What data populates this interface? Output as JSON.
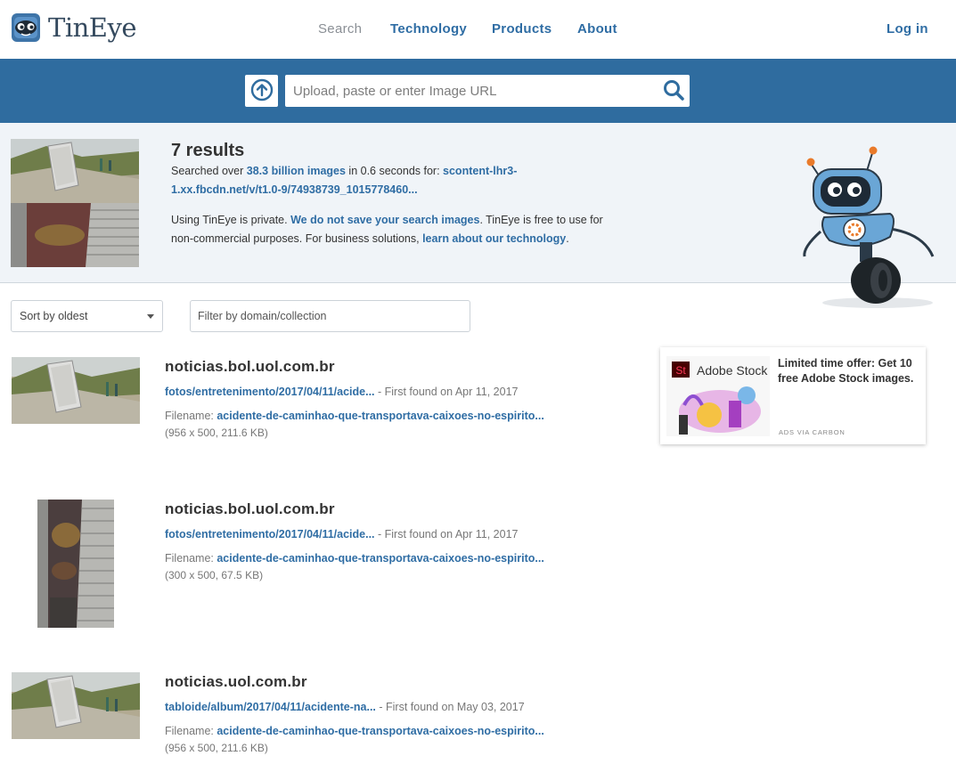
{
  "brand": {
    "name": "TinEye",
    "icon": "tineye-logo-icon"
  },
  "nav": {
    "items": [
      {
        "label": "Search",
        "active": true
      },
      {
        "label": "Technology"
      },
      {
        "label": "Products"
      },
      {
        "label": "About"
      }
    ],
    "login": "Log in"
  },
  "search": {
    "placeholder": "Upload, paste or enter Image URL",
    "upload_icon": "upload-arrow-icon",
    "search_icon": "magnifier-icon"
  },
  "summary": {
    "count": "7 results",
    "searched_prefix": "Searched over ",
    "images_count": "38.3 billion images",
    "searched_middle": " in 0.6 seconds for: ",
    "query_url": "scontent-lhr3-1.xx.fbcdn.net/v/t1.0-9/74938739_1015778460...",
    "privacy_1": "Using TinEye is private. ",
    "privacy_link": "We do not save your search images",
    "privacy_2": ". TinEye is free to use for non-commercial purposes. For business solutions, ",
    "tech_link": "learn about our technology",
    "privacy_3": "."
  },
  "filters": {
    "sort_selected": "Sort by oldest",
    "filter_placeholder": "Filter by domain/collection"
  },
  "results": [
    {
      "domain": "noticias.bol.uol.com.br",
      "path": "fotos/entretenimento/2017/04/11/acide...",
      "first_found": " - First found on Apr 11, 2017",
      "filename_label": "Filename: ",
      "filename": "acidente-de-caminhao-que-transportava-caixoes-no-espirito...",
      "dims": "(956 x 500, 211.6 KB)"
    },
    {
      "domain": "noticias.bol.uol.com.br",
      "path": "fotos/entretenimento/2017/04/11/acide...",
      "first_found": " - First found on Apr 11, 2017",
      "filename_label": "Filename: ",
      "filename": "acidente-de-caminhao-que-transportava-caixoes-no-espirito...",
      "dims": "(300 x 500, 67.5 KB)"
    },
    {
      "domain": "noticias.uol.com.br",
      "path": "tabloide/album/2017/04/11/acidente-na...",
      "first_found": " - First found on May 03, 2017",
      "filename_label": "Filename: ",
      "filename": "acidente-de-caminhao-que-transportava-caixoes-no-espirito...",
      "dims": "(956 x 500, 211.6 KB)"
    }
  ],
  "ad": {
    "brand_badge": "St",
    "brand_name": "Adobe Stock",
    "text": "Limited time offer: Get 10 free Adobe Stock images.",
    "via": "ADS VIA CARBON"
  },
  "colors": {
    "primary": "#2f6c9f",
    "link": "#2f6da4",
    "summary_bg": "#f0f4f8"
  }
}
